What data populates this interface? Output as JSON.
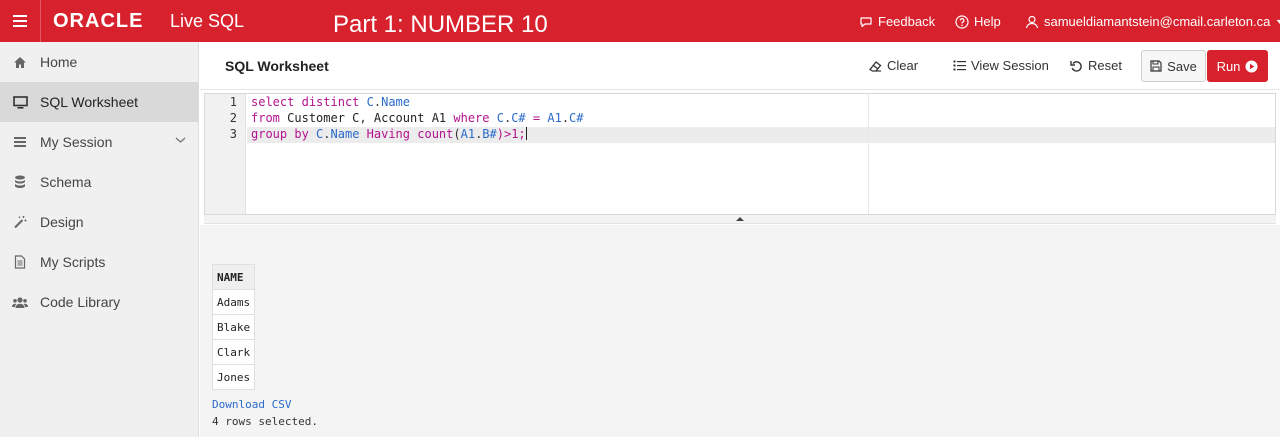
{
  "header": {
    "logo": "ORACLE",
    "product": "Live SQL",
    "overlay_title": "Part 1: NUMBER 10",
    "feedback": "Feedback",
    "help": "Help",
    "user": "samueldiamantstein@cmail.carleton.ca"
  },
  "sidebar": {
    "items": [
      {
        "label": "Home",
        "icon": "home-icon"
      },
      {
        "label": "SQL Worksheet",
        "icon": "monitor-icon"
      },
      {
        "label": "My Session",
        "icon": "list-icon"
      },
      {
        "label": "Schema",
        "icon": "database-icon"
      },
      {
        "label": "Design",
        "icon": "wand-icon"
      },
      {
        "label": "My Scripts",
        "icon": "file-icon"
      },
      {
        "label": "Code Library",
        "icon": "users-icon"
      }
    ]
  },
  "toolbar": {
    "title": "SQL Worksheet",
    "clear": "Clear",
    "view_session": "View Session",
    "reset": "Reset",
    "save": "Save",
    "run": "Run"
  },
  "editor": {
    "line_numbers": [
      "1",
      "2",
      "3"
    ],
    "lines": [
      "select distinct C.Name",
      "from Customer C, Account A1 where C.C# = A1.C#",
      "group by C.Name Having count(A1.B#)>1;"
    ]
  },
  "results": {
    "column": "NAME",
    "rows": [
      "Adams",
      "Blake",
      "Clark",
      "Jones"
    ],
    "download": "Download CSV",
    "status": "4 rows selected."
  },
  "colors": {
    "brand_red": "#d7222e",
    "keyword": "#b4128f",
    "identifier": "#2b6acb"
  }
}
